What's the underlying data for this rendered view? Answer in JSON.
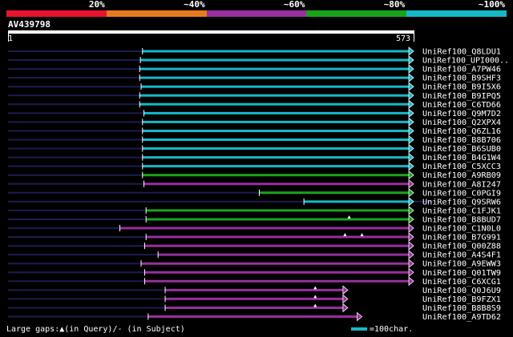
{
  "legend": {
    "segments": [
      {
        "label": "20%",
        "color": "#e8142e"
      },
      {
        "label": "~40%",
        "color": "#e87a1e"
      },
      {
        "label": "~60%",
        "color": "#9a2e9e"
      },
      {
        "label": "~80%",
        "color": "#1aa31a"
      },
      {
        "label": "~100%",
        "color": "#16b8c8"
      }
    ]
  },
  "query": {
    "id": "AV439798",
    "start_label": "1",
    "end_label": "573",
    "length": 573
  },
  "colors": {
    "cyan": "#16b8c8",
    "green": "#1aa31a",
    "purple": "#9a2e9e",
    "navy": "#1c1c4e",
    "gap": "#ffffff"
  },
  "hits": [
    {
      "name": "UniRef100_Q8LDU1",
      "color": "cyan",
      "start": 190,
      "end": 573,
      "context": [
        0,
        190
      ]
    },
    {
      "name": "UniRef100_UPI000..",
      "color": "cyan",
      "start": 187,
      "end": 573,
      "context": [
        0,
        187
      ]
    },
    {
      "name": "UniRef100_A7PW46",
      "color": "cyan",
      "start": 186,
      "end": 573,
      "context": [
        0,
        186
      ]
    },
    {
      "name": "UniRef100_B9SHF3",
      "color": "cyan",
      "start": 186,
      "end": 573,
      "context": [
        0,
        186
      ]
    },
    {
      "name": "UniRef100_B9I5X6",
      "color": "cyan",
      "start": 188,
      "end": 573,
      "context": [
        0,
        188
      ]
    },
    {
      "name": "UniRef100_B9IPQ5",
      "color": "cyan",
      "start": 186,
      "end": 573,
      "context": [
        0,
        186
      ]
    },
    {
      "name": "UniRef100_C6TD66",
      "color": "cyan",
      "start": 186,
      "end": 573,
      "context": [
        0,
        186
      ]
    },
    {
      "name": "UniRef100_Q9M7D2",
      "color": "cyan",
      "start": 192,
      "end": 573,
      "context": [
        0,
        192
      ]
    },
    {
      "name": "UniRef100_Q2XPX4",
      "color": "cyan",
      "start": 190,
      "end": 573,
      "context": [
        0,
        190
      ]
    },
    {
      "name": "UniRef100_Q6ZL16",
      "color": "cyan",
      "start": 190,
      "end": 573,
      "context": [
        0,
        190
      ]
    },
    {
      "name": "UniRef100_B8B706",
      "color": "cyan",
      "start": 190,
      "end": 573,
      "context": [
        0,
        190
      ]
    },
    {
      "name": "UniRef100_B6SUB0",
      "color": "cyan",
      "start": 190,
      "end": 573,
      "context": [
        0,
        190
      ]
    },
    {
      "name": "UniRef100_B4G1W4",
      "color": "cyan",
      "start": 190,
      "end": 573,
      "context": [
        0,
        190
      ]
    },
    {
      "name": "UniRef100_C5XCC3",
      "color": "cyan",
      "start": 190,
      "end": 573,
      "context": [
        0,
        190
      ]
    },
    {
      "name": "UniRef100_A9RB09",
      "color": "green",
      "start": 190,
      "end": 573,
      "context": [
        0,
        190
      ]
    },
    {
      "name": "UniRef100_A8I247",
      "color": "purple",
      "start": 192,
      "end": 573,
      "context": [
        0,
        192
      ],
      "tail": [
        551,
        565
      ]
    },
    {
      "name": "UniRef100_C0PGI9",
      "color": "green",
      "start": 355,
      "end": 573,
      "context": [
        0,
        355
      ]
    },
    {
      "name": "UniRef100_Q9SRW6",
      "color": "cyan",
      "start": 418,
      "end": 573,
      "context": [
        0,
        418
      ],
      "tail": [
        573,
        600
      ]
    },
    {
      "name": "UniRef100_C1FJK1",
      "color": "green",
      "start": 195,
      "end": 573,
      "context": [
        0,
        195
      ],
      "tail": [
        551,
        565
      ]
    },
    {
      "name": "UniRef100_B8BUD7",
      "color": "green",
      "start": 195,
      "end": 573,
      "context": [
        0,
        195
      ],
      "gaps": [
        482
      ]
    },
    {
      "name": "UniRef100_C1N0L0",
      "color": "purple",
      "start": 158,
      "end": 573,
      "context": [
        0,
        158
      ],
      "tail": [
        551,
        565
      ]
    },
    {
      "name": "UniRef100_B7G991",
      "color": "purple",
      "start": 195,
      "end": 573,
      "context": [
        0,
        195
      ],
      "gaps": [
        476,
        500
      ]
    },
    {
      "name": "UniRef100_Q00Z88",
      "color": "purple",
      "start": 193,
      "end": 573,
      "context": [
        0,
        193
      ]
    },
    {
      "name": "UniRef100_A4S4F1",
      "color": "purple",
      "start": 212,
      "end": 573,
      "context": [
        0,
        212
      ]
    },
    {
      "name": "UniRef100_A9EWW3",
      "color": "purple",
      "start": 188,
      "end": 573,
      "context": [
        0,
        188
      ]
    },
    {
      "name": "UniRef100_Q01TW9",
      "color": "purple",
      "start": 193,
      "end": 573,
      "context": [
        0,
        193
      ]
    },
    {
      "name": "UniRef100_C6XCG1",
      "color": "purple",
      "start": 193,
      "end": 573,
      "context": [
        0,
        193
      ],
      "tail": [
        537,
        565
      ]
    },
    {
      "name": "UniRef100_Q0J6U9",
      "color": "purple",
      "start": 222,
      "end": 480,
      "context": [
        0,
        222
      ],
      "gaps": [
        434
      ]
    },
    {
      "name": "UniRef100_B9FZX1",
      "color": "purple",
      "start": 222,
      "end": 480,
      "context": [
        0,
        222
      ],
      "gaps": [
        434
      ]
    },
    {
      "name": "UniRef100_B8B8S9",
      "color": "purple",
      "start": 222,
      "end": 480,
      "context": [
        0,
        222
      ],
      "gaps": [
        434
      ]
    },
    {
      "name": "UniRef100_A9TD62",
      "color": "purple",
      "start": 198,
      "end": 500,
      "context": [
        0,
        198
      ]
    }
  ],
  "footer": {
    "legend_text": "Large gaps:▲(in Query)/- (in Subject)",
    "scale_label": "=100char."
  }
}
